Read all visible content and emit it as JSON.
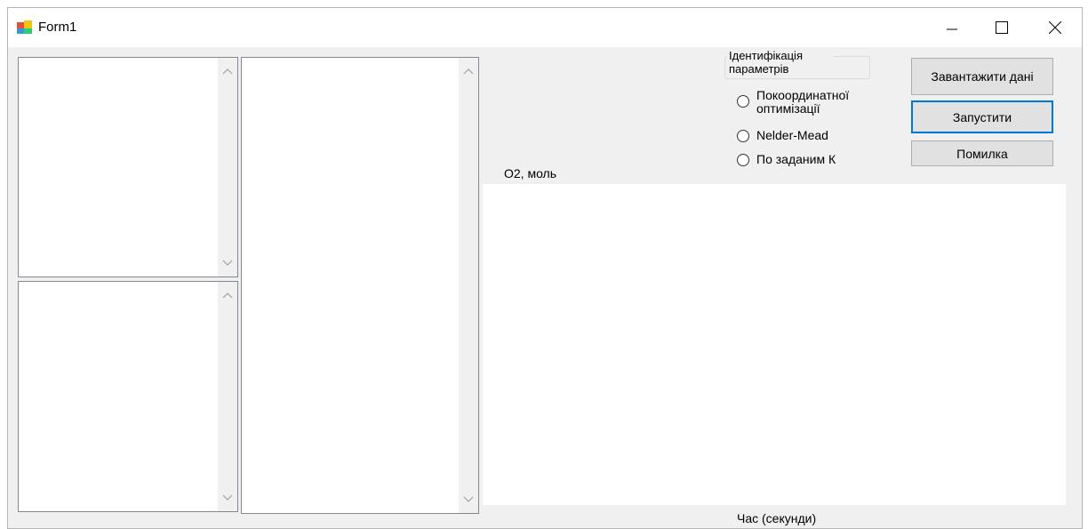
{
  "window": {
    "title": "Form1"
  },
  "group": {
    "title_line1": "Ідентифікація",
    "title_line2": "параметрів"
  },
  "radios": [
    {
      "label_line1": "Покоординатної",
      "label_line2": "оптимізації",
      "checked": false
    },
    {
      "label": "Nelder-Mead",
      "checked": false
    },
    {
      "label": "По заданим К",
      "checked": false
    }
  ],
  "buttons": {
    "load": "Завантажити дані",
    "run": "Запустити",
    "error": "Помилка"
  },
  "chart": {
    "ylabel": "O2, моль",
    "xlabel": "Час (секунди)"
  },
  "colors": {
    "focus": "#0078d7",
    "button_bg": "#e1e1e1",
    "client_bg": "#f0f0f0"
  }
}
